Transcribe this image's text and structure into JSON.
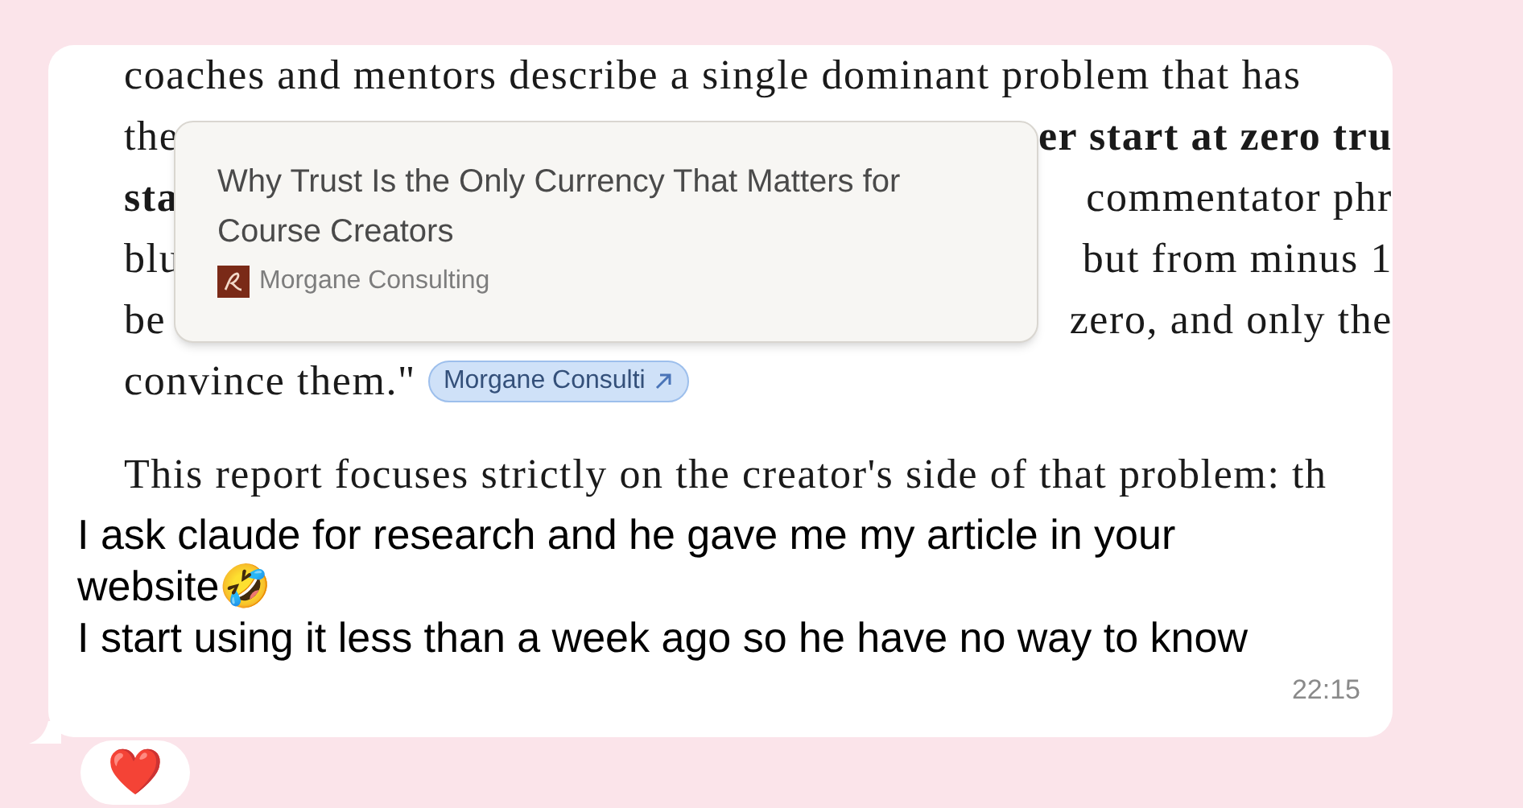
{
  "document": {
    "lines": [
      {
        "left": {
          "text": "coaches and mentors describe a single dominant problem that has",
          "bold": false
        }
      },
      {
        "left": {
          "text": "the",
          "bold": false
        },
        "right": {
          "text": "er start at zero tru",
          "bold": true
        }
      },
      {
        "left": {
          "text": "sta",
          "bold": true
        },
        "right": {
          "text": "commentator phr",
          "bold": false
        }
      },
      {
        "left": {
          "text": "blu",
          "bold": false
        },
        "right": {
          "text": "but from minus 1",
          "bold": false
        }
      },
      {
        "left": {
          "text": "be",
          "bold": false
        },
        "right": {
          "text": "zero, and only the",
          "bold": false
        }
      },
      {
        "left": {
          "text": "convince them.\"",
          "bold": false
        },
        "chip": "Morgane Consulti"
      },
      {
        "left": {
          "text": "This report focuses strictly on the creator's side of that problem: th",
          "bold": false
        }
      }
    ],
    "tooltip": {
      "title": "Why Trust Is the Only Currency That Matters for Course Creators",
      "source": "Morgane Consulting"
    }
  },
  "message": {
    "paragraphs": [
      "I ask claude for research and he gave me my article in your website🤣",
      "I start using it less than a week ago so he have no way to know"
    ],
    "time": "22:15"
  },
  "reaction": "❤️"
}
